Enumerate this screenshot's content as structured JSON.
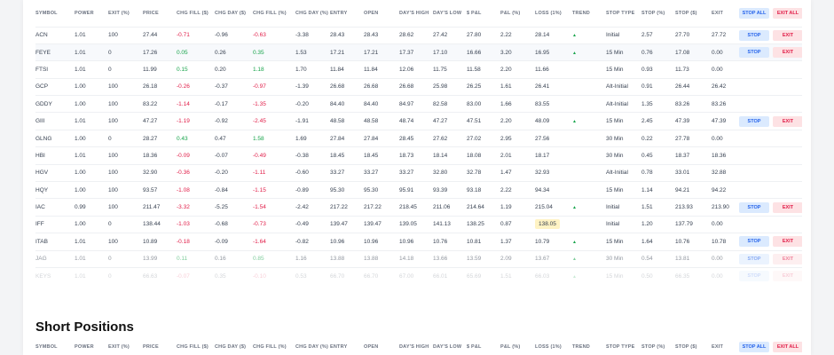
{
  "columns": [
    "SYMBOL",
    "POWER",
    "EXIT (%)",
    "PRICE",
    "CHG FILL ($)",
    "CHG DAY ($)",
    "CHG FILL (%)",
    "CHG DAY (%)",
    "ENTRY",
    "OPEN",
    "DAY'S HIGH",
    "DAY'S LOW",
    "$ P&L",
    "P&L (%)",
    "LOSS (1%)",
    "TREND",
    "STOP TYPE",
    "STOP (%)",
    "STOP ($)",
    "EXIT"
  ],
  "buttons": {
    "stop_all": "STOP ALL",
    "exit_all": "EXIT ALL",
    "stop": "STOP",
    "exit": "EXIT"
  },
  "long_rows": [
    {
      "symbol": "ACN",
      "power": "1.01",
      "exit_pct": "100",
      "price": "27.44",
      "chg_fill": "-0.71",
      "chg_day": "-0.96",
      "chg_fill_pct": "-0.63",
      "chg_day_pct": "-3.38",
      "entry": "28.43",
      "open": "28.43",
      "high": "28.62",
      "low": "27.42",
      "pnl": "27.80",
      "pnl_pct": "2.22",
      "loss": "28.14",
      "trend": "▲",
      "stop_type": "Initial",
      "stop_pct": "2.57",
      "stop_usd": "27.70",
      "exit": "27.72",
      "stop_btn": "STOP",
      "exit_btn": "EXIT"
    },
    {
      "symbol": "FEYE",
      "power": "1.01",
      "exit_pct": "0",
      "price": "17.26",
      "chg_fill": "0.05",
      "chg_day": "0.26",
      "chg_fill_pct": "0.35",
      "chg_day_pct": "1.53",
      "entry": "17.21",
      "open": "17.21",
      "high": "17.37",
      "low": "17.10",
      "pnl": "16.66",
      "pnl_pct": "3.20",
      "loss": "16.95",
      "trend": "▲",
      "stop_type": "15 Min",
      "stop_pct": "0.76",
      "stop_usd": "17.08",
      "exit": "0.00",
      "stop_btn": "STOP",
      "exit_btn": "EXIT"
    },
    {
      "symbol": "FTSI",
      "power": "1.01",
      "exit_pct": "0",
      "price": "11.99",
      "chg_fill": "0.15",
      "chg_day": "0.20",
      "chg_fill_pct": "1.18",
      "chg_day_pct": "1.70",
      "entry": "11.84",
      "open": "11.84",
      "high": "12.06",
      "low": "11.75",
      "pnl": "11.58",
      "pnl_pct": "2.20",
      "loss": "11.66",
      "trend": "",
      "stop_type": "15 Min",
      "stop_pct": "0.93",
      "stop_usd": "11.73",
      "exit": "0.00",
      "stop_btn": "",
      "exit_btn": ""
    },
    {
      "symbol": "GCP",
      "power": "1.00",
      "exit_pct": "100",
      "price": "26.18",
      "chg_fill": "-0.26",
      "chg_day": "-0.37",
      "chg_fill_pct": "-0.97",
      "chg_day_pct": "-1.39",
      "entry": "26.68",
      "open": "26.68",
      "high": "26.68",
      "low": "25.98",
      "pnl": "26.25",
      "pnl_pct": "1.61",
      "loss": "26.41",
      "trend": "",
      "stop_type": "Alt-Initial",
      "stop_pct": "0.91",
      "stop_usd": "26.44",
      "exit": "26.42",
      "stop_btn": "",
      "exit_btn": ""
    },
    {
      "symbol": "GDDY",
      "power": "1.00",
      "exit_pct": "100",
      "price": "83.22",
      "chg_fill": "-1.14",
      "chg_day": "-0.17",
      "chg_fill_pct": "-1.35",
      "chg_day_pct": "-0.20",
      "entry": "84.40",
      "open": "84.40",
      "high": "84.97",
      "low": "82.58",
      "pnl": "83.00",
      "pnl_pct": "1.66",
      "loss": "83.55",
      "trend": "",
      "stop_type": "Alt-Initial",
      "stop_pct": "1.35",
      "stop_usd": "83.26",
      "exit": "83.26",
      "stop_btn": "",
      "exit_btn": ""
    },
    {
      "symbol": "GIII",
      "power": "1.01",
      "exit_pct": "100",
      "price": "47.27",
      "chg_fill": "-1.19",
      "chg_day": "-0.92",
      "chg_fill_pct": "-2.45",
      "chg_day_pct": "-1.91",
      "entry": "48.58",
      "open": "48.58",
      "high": "48.74",
      "low": "47.27",
      "pnl": "47.51",
      "pnl_pct": "2.20",
      "loss": "48.09",
      "trend": "▲",
      "stop_type": "15 Min",
      "stop_pct": "2.45",
      "stop_usd": "47.39",
      "exit": "47.39",
      "stop_btn": "STOP",
      "exit_btn": "EXIT"
    },
    {
      "symbol": "GLNG",
      "power": "1.00",
      "exit_pct": "0",
      "price": "28.27",
      "chg_fill": "0.43",
      "chg_day": "0.47",
      "chg_fill_pct": "1.58",
      "chg_day_pct": "1.69",
      "entry": "27.84",
      "open": "27.84",
      "high": "28.45",
      "low": "27.62",
      "pnl": "27.02",
      "pnl_pct": "2.95",
      "loss": "27.56",
      "trend": "",
      "stop_type": "30 Min",
      "stop_pct": "0.22",
      "stop_usd": "27.78",
      "exit": "0.00",
      "stop_btn": "",
      "exit_btn": ""
    },
    {
      "symbol": "HBI",
      "power": "1.01",
      "exit_pct": "100",
      "price": "18.36",
      "chg_fill": "-0.09",
      "chg_day": "-0.07",
      "chg_fill_pct": "-0.49",
      "chg_day_pct": "-0.38",
      "entry": "18.45",
      "open": "18.45",
      "high": "18.73",
      "low": "18.14",
      "pnl": "18.08",
      "pnl_pct": "2.01",
      "loss": "18.17",
      "trend": "",
      "stop_type": "30 Min",
      "stop_pct": "0.45",
      "stop_usd": "18.37",
      "exit": "18.36",
      "stop_btn": "",
      "exit_btn": ""
    },
    {
      "symbol": "HGV",
      "power": "1.00",
      "exit_pct": "100",
      "price": "32.90",
      "chg_fill": "-0.36",
      "chg_day": "-0.20",
      "chg_fill_pct": "-1.11",
      "chg_day_pct": "-0.60",
      "entry": "33.27",
      "open": "33.27",
      "high": "33.27",
      "low": "32.80",
      "pnl": "32.78",
      "pnl_pct": "1.47",
      "loss": "32.93",
      "trend": "",
      "stop_type": "Alt-Initial",
      "stop_pct": "0.78",
      "stop_usd": "33.01",
      "exit": "32.88",
      "stop_btn": "",
      "exit_btn": ""
    },
    {
      "symbol": "HQY",
      "power": "1.00",
      "exit_pct": "100",
      "price": "93.57",
      "chg_fill": "-1.08",
      "chg_day": "-0.84",
      "chg_fill_pct": "-1.15",
      "chg_day_pct": "-0.89",
      "entry": "95.30",
      "open": "95.30",
      "high": "95.91",
      "low": "93.39",
      "pnl": "93.18",
      "pnl_pct": "2.22",
      "loss": "94.34",
      "trend": "",
      "stop_type": "15 Min",
      "stop_pct": "1.14",
      "stop_usd": "94.21",
      "exit": "94.22",
      "stop_btn": "",
      "exit_btn": ""
    },
    {
      "symbol": "IAC",
      "power": "0.99",
      "exit_pct": "100",
      "price": "211.47",
      "chg_fill": "-3.32",
      "chg_day": "-5.25",
      "chg_fill_pct": "-1.54",
      "chg_day_pct": "-2.42",
      "entry": "217.22",
      "open": "217.22",
      "high": "218.45",
      "low": "211.06",
      "pnl": "214.64",
      "pnl_pct": "1.19",
      "loss": "215.04",
      "trend": "▲",
      "stop_type": "Initial",
      "stop_pct": "1.51",
      "stop_usd": "213.93",
      "exit": "213.90",
      "stop_btn": "STOP",
      "exit_btn": "EXIT"
    },
    {
      "symbol": "IFF",
      "power": "1.00",
      "exit_pct": "0",
      "price": "138.44",
      "chg_fill": "-1.03",
      "chg_day": "-0.68",
      "chg_fill_pct": "-0.73",
      "chg_day_pct": "-0.49",
      "entry": "139.47",
      "open": "139.47",
      "high": "139.05",
      "low": "141.13",
      "pnl": "138.25",
      "pnl_pct": "0.87",
      "loss": "138.05",
      "trend": "",
      "stop_type": "Initial",
      "stop_pct": "1.20",
      "stop_usd": "137.79",
      "exit": "0.00",
      "stop_btn": "",
      "exit_btn": ""
    },
    {
      "symbol": "ITAB",
      "power": "1.01",
      "exit_pct": "100",
      "price": "10.89",
      "chg_fill": "-0.18",
      "chg_day": "-0.09",
      "chg_fill_pct": "-1.64",
      "chg_day_pct": "-0.82",
      "entry": "10.96",
      "open": "10.96",
      "high": "10.96",
      "low": "10.76",
      "pnl": "10.81",
      "pnl_pct": "1.37",
      "loss": "10.79",
      "trend": "▲",
      "stop_type": "15 Min",
      "stop_pct": "1.64",
      "stop_usd": "10.76",
      "exit": "10.78",
      "stop_btn": "STOP",
      "exit_btn": "EXIT"
    },
    {
      "symbol": "JAG",
      "power": "1.01",
      "exit_pct": "0",
      "price": "13.99",
      "chg_fill": "0.11",
      "chg_day": "0.16",
      "chg_fill_pct": "0.85",
      "chg_day_pct": "1.16",
      "entry": "13.88",
      "open": "13.88",
      "high": "14.18",
      "low": "13.66",
      "pnl": "13.59",
      "pnl_pct": "2.09",
      "loss": "13.67",
      "trend": "▲",
      "stop_type": "30 Min",
      "stop_pct": "0.54",
      "stop_usd": "13.81",
      "exit": "0.00",
      "stop_btn": "STOP",
      "exit_btn": "EXIT"
    },
    {
      "symbol": "KEYS",
      "power": "1.01",
      "exit_pct": "0",
      "price": "66.63",
      "chg_fill": "-0.07",
      "chg_day": "0.35",
      "chg_fill_pct": "-0.10",
      "chg_day_pct": "0.53",
      "entry": "66.70",
      "open": "66.70",
      "high": "67.00",
      "low": "66.01",
      "pnl": "65.69",
      "pnl_pct": "1.51",
      "loss": "66.03",
      "trend": "▲",
      "stop_type": "15 Min",
      "stop_pct": "0.50",
      "stop_usd": "66.35",
      "exit": "0.00",
      "stop_btn": "STOP",
      "exit_btn": "EXIT"
    }
  ],
  "short_section": {
    "title": "Short Positions"
  }
}
